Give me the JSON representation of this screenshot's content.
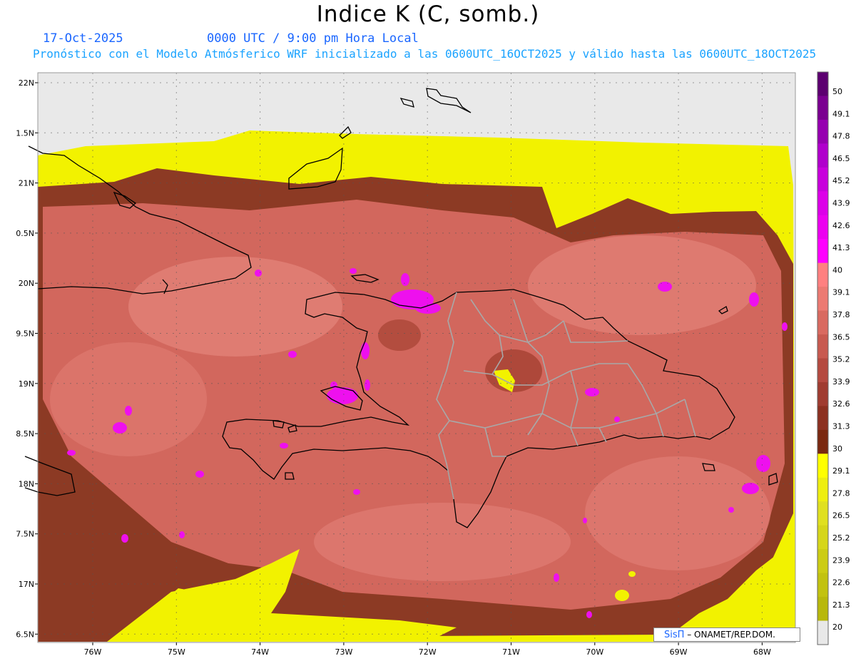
{
  "header": {
    "title": "Indice K (C, somb.)",
    "date": "17-Oct-2025",
    "time": "0000 UTC / 9:00 pm Hora Local",
    "subtitle": "Pronóstico con el Modelo Atmósferico WRF inicializado a las 0600UTC_16OCT2025 y válido hasta las  0600UTC_18OCT2025"
  },
  "map": {
    "lon_range": [
      -76.7,
      -67.6
    ],
    "lat_range": [
      16.4,
      22.1
    ],
    "lat_labels": [
      "22N",
      "1.5N",
      "21N",
      "0.5N",
      "20N",
      "9.5N",
      "19N",
      "8.5N",
      "18N",
      "7.5N",
      "17N",
      "6.5N"
    ],
    "lon_labels": [
      "76W",
      "75W",
      "74W",
      "73W",
      "72W",
      "71W",
      "70W",
      "69W",
      "68W"
    ],
    "colors": {
      "no_data": "#e9e9e9",
      "coast": "#000000",
      "borders": "#a0a0a0"
    }
  },
  "colorbar": {
    "labels": [
      "50",
      "49.1",
      "47.8",
      "46.5",
      "45.2",
      "43.9",
      "42.6",
      "41.3",
      "40",
      "39.1",
      "37.8",
      "36.5",
      "35.2",
      "33.9",
      "32.6",
      "31.3",
      "30",
      "29.1",
      "27.8",
      "26.5",
      "25.2",
      "23.9",
      "22.6",
      "21.3",
      "20"
    ],
    "colors": [
      "#5c0070",
      "#7a0090",
      "#9600b0",
      "#b000cc",
      "#c800dc",
      "#dc00e8",
      "#ec00f0",
      "#ff00ff",
      "#ff8080",
      "#ec7a72",
      "#d96a60",
      "#c85a50",
      "#b54a40",
      "#a03c30",
      "#8c3020",
      "#7a2810",
      "#ffff00",
      "#eeee10",
      "#e0e020",
      "#d6d61a",
      "#cccc14",
      "#c2c210",
      "#b8b80c",
      "#e8e8e8"
    ]
  },
  "credit": {
    "brand": "SisΠ",
    "text": " – ONAMET/REP.DOM."
  }
}
